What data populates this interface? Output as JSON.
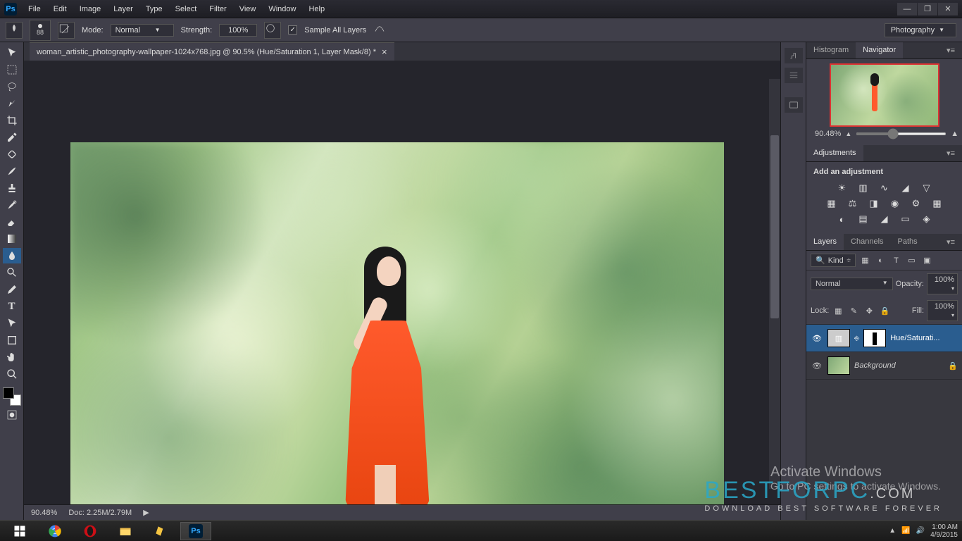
{
  "titlebar": {
    "logo": "Ps"
  },
  "menus": [
    "File",
    "Edit",
    "Image",
    "Layer",
    "Type",
    "Select",
    "Filter",
    "View",
    "Window",
    "Help"
  ],
  "optionsbar": {
    "brush_size": "88",
    "mode_label": "Mode:",
    "mode_value": "Normal",
    "strength_label": "Strength:",
    "strength_value": "100%",
    "sample_label": "Sample All Layers",
    "workspace": "Photography"
  },
  "document": {
    "tab_title": "woman_artistic_photography-wallpaper-1024x768.jpg @ 90.5% (Hue/Saturation 1, Layer Mask/8) *",
    "zoom": "90.48%",
    "doc_size": "Doc: 2.25M/2.79M"
  },
  "navigator": {
    "tab_histogram": "Histogram",
    "tab_navigator": "Navigator",
    "zoom": "90.48%"
  },
  "adjustments": {
    "title": "Adjustments",
    "subtitle": "Add an adjustment"
  },
  "layers_panel": {
    "tab_layers": "Layers",
    "tab_channels": "Channels",
    "tab_paths": "Paths",
    "filter_kind": "Kind",
    "blend_mode": "Normal",
    "opacity_label": "Opacity:",
    "opacity_value": "100%",
    "lock_label": "Lock:",
    "fill_label": "Fill:",
    "fill_value": "100%",
    "layers": [
      {
        "name": "Hue/Saturati...",
        "locked": false
      },
      {
        "name": "Background",
        "locked": true
      }
    ]
  },
  "watermark": {
    "activate_title": "Activate Windows",
    "activate_sub": "Go to PC settings to activate Windows.",
    "brand": "BESTFORPC",
    "brand_sub": "DOWNLOAD BEST SOFTWARE FOREVER"
  },
  "tray": {
    "time": "1:00 AM",
    "date": "4/9/2015"
  }
}
